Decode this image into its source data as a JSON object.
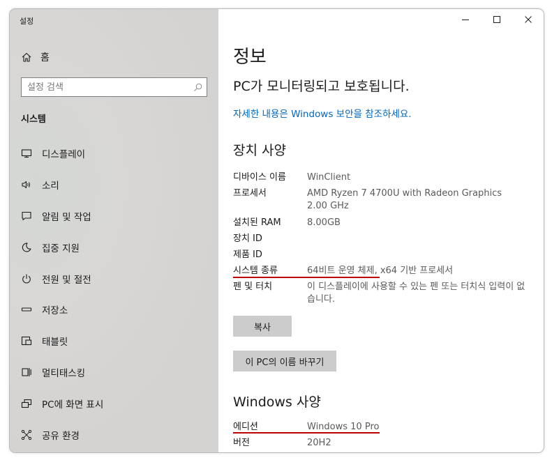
{
  "app": {
    "title": "설정"
  },
  "sidebar": {
    "home_label": "홈",
    "search_placeholder": "설정 검색",
    "section_title": "시스템",
    "items": [
      {
        "label": "디스플레이",
        "icon": "display-icon"
      },
      {
        "label": "소리",
        "icon": "speaker-icon"
      },
      {
        "label": "알림 및 작업",
        "icon": "notification-icon"
      },
      {
        "label": "집중 지원",
        "icon": "moon-icon"
      },
      {
        "label": "전원 및 절전",
        "icon": "power-icon"
      },
      {
        "label": "저장소",
        "icon": "storage-icon"
      },
      {
        "label": "태블릿",
        "icon": "tablet-icon"
      },
      {
        "label": "멀티태스킹",
        "icon": "multitasking-icon"
      },
      {
        "label": "PC에 화면 표시",
        "icon": "project-icon"
      },
      {
        "label": "공유 환경",
        "icon": "shared-experiences-icon"
      }
    ]
  },
  "window_controls": {
    "minimize": "–",
    "maximize": "☐",
    "close": "✕"
  },
  "main": {
    "title": "정보",
    "status": "PC가 모니터링되고 보호됩니다.",
    "link": "자세한 내용은 Windows 보안을 참조하세요.",
    "device_specs": {
      "heading": "장치 사양",
      "rows": [
        {
          "key": "디바이스 이름",
          "value": "WinClient"
        },
        {
          "key": "프로세서",
          "value": "AMD Ryzen 7 4700U with Radeon Graphics 2.00 GHz"
        },
        {
          "key": "설치된 RAM",
          "value": "8.00GB"
        },
        {
          "key": "장치 ID",
          "value": ""
        },
        {
          "key": "제품 ID",
          "value": ""
        },
        {
          "key": "시스템 종류",
          "value": "64비트 운영 체제, x64 기반 프로세서"
        },
        {
          "key": "펜 및 터치",
          "value": "이 디스플레이에 사용할 수 있는 펜 또는 터치식 입력이 없습니다."
        }
      ],
      "copy_button": "복사",
      "rename_button": "이 PC의 이름 바꾸기"
    },
    "windows_specs": {
      "heading": "Windows 사양",
      "rows": [
        {
          "key": "에디션",
          "value": "Windows 10 Pro"
        },
        {
          "key": "버전",
          "value": "20H2"
        }
      ]
    }
  },
  "colors": {
    "link": "#0067c0",
    "highlight_underline": "#c00000",
    "sidebar_bg": "#d6d5d3",
    "button_bg": "#cccccc"
  }
}
